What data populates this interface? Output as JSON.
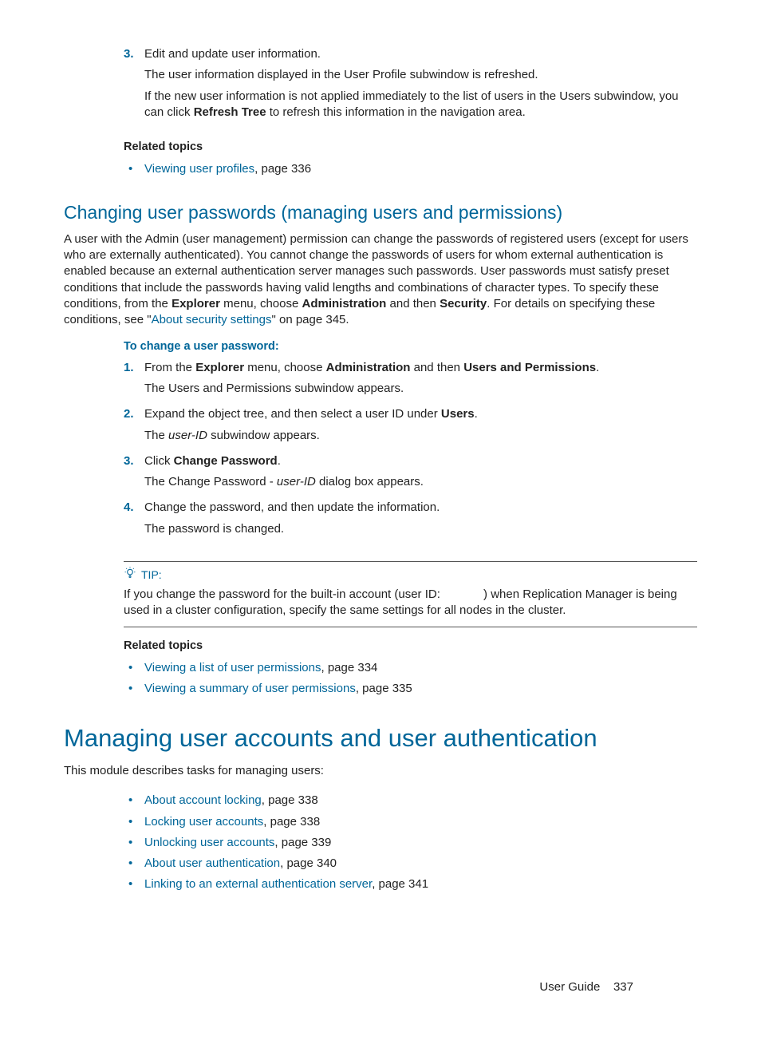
{
  "top_steps": {
    "items": [
      {
        "num": "3.",
        "text": "Edit and update user information.",
        "subs": [
          "The user information displayed in the User Profile subwindow is refreshed.",
          "If the new user information is not applied immediately to the list of users in the Users subwindow, you can click <b>Refresh Tree</b> to refresh this information in the navigation area."
        ]
      }
    ],
    "related_label": "Related topics",
    "related": [
      {
        "link": "Viewing user profiles",
        "suffix": ", page 336"
      }
    ]
  },
  "sec1": {
    "heading": "Changing user passwords (managing users and permissions)",
    "intro": "A user with the Admin (user management) permission can change the passwords of registered users (except for users who are externally authenticated). You cannot change the passwords of users for whom external authentication is enabled because an external authentication server manages such passwords. User passwords must satisfy preset conditions that include the passwords having valid lengths and combinations of character types. To specify these conditions, from the <b>Explorer</b> menu, choose <b>Administration</b> and then <b>Security</b>. For details on specifying these conditions, see \"<span class='link'>About security settings</span>\" on page 345.",
    "proc_label": "To change a user password:",
    "steps": [
      {
        "num": "1.",
        "text": "From the <b>Explorer</b> menu, choose <b>Administration</b> and then <b>Users and Permissions</b>.",
        "subs": [
          "The Users and Permissions subwindow appears."
        ]
      },
      {
        "num": "2.",
        "text": "Expand the object tree, and then select a user ID under <b>Users</b>.",
        "subs": [
          "The <i>user-ID</i> subwindow appears."
        ]
      },
      {
        "num": "3.",
        "text": "Click <b>Change Password</b>.",
        "subs": [
          "The Change Password - <i>user-ID</i> dialog box appears."
        ]
      },
      {
        "num": "4.",
        "text": "Change the password, and then update the information.",
        "subs": [
          "The password is changed."
        ]
      }
    ],
    "tip_label": "TIP:",
    "tip_body": "If you change the password for the built-in account (user ID: &nbsp;&nbsp;&nbsp;&nbsp;&nbsp;&nbsp;&nbsp;&nbsp;&nbsp;&nbsp;&nbsp;&nbsp;) when Replication Manager is being used in a cluster configuration, specify the same settings for all nodes in the cluster.",
    "related_label": "Related topics",
    "related": [
      {
        "link": "Viewing a list of user permissions",
        "suffix": ", page 334"
      },
      {
        "link": "Viewing a summary of user permissions",
        "suffix": ", page 335"
      }
    ]
  },
  "sec2": {
    "heading": "Managing user accounts and user authentication",
    "intro": "This module describes tasks for managing users:",
    "links": [
      {
        "link": "About account locking",
        "suffix": ", page 338"
      },
      {
        "link": "Locking user accounts",
        "suffix": ", page 338"
      },
      {
        "link": "Unlocking user accounts",
        "suffix": ", page 339"
      },
      {
        "link": "About user authentication",
        "suffix": ", page 340"
      },
      {
        "link": "Linking to an external authentication server",
        "suffix": ", page 341"
      }
    ]
  },
  "footer": {
    "label": "User Guide",
    "page": "337"
  }
}
